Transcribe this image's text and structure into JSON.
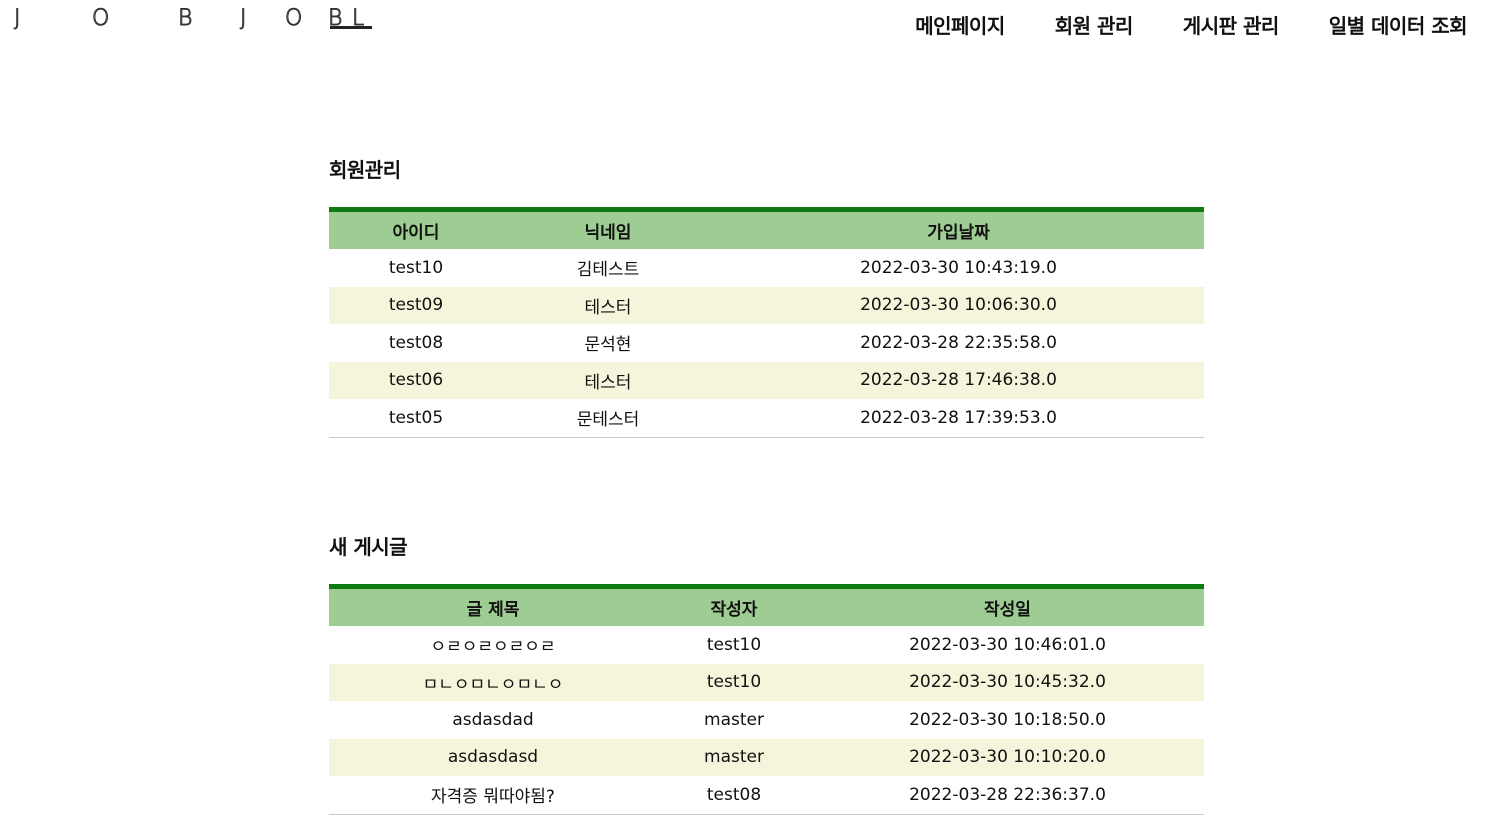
{
  "header": {
    "logo_letters": [
      "J",
      "O",
      "B",
      "J",
      "O",
      "B",
      "L"
    ],
    "nav": [
      {
        "label": "메인페이지"
      },
      {
        "label": "회원 관리"
      },
      {
        "label": "게시판 관리"
      },
      {
        "label": "일별 데이터 조회"
      }
    ]
  },
  "members": {
    "title": "회원관리",
    "columns": [
      "아이디",
      "닉네임",
      "가입날짜"
    ],
    "rows": [
      {
        "id": "test10",
        "nickname": "김테스트",
        "joined": "2022-03-30 10:43:19.0"
      },
      {
        "id": "test09",
        "nickname": "테스터",
        "joined": "2022-03-30 10:06:30.0"
      },
      {
        "id": "test08",
        "nickname": "문석현",
        "joined": "2022-03-28 22:35:58.0"
      },
      {
        "id": "test06",
        "nickname": "테스터",
        "joined": "2022-03-28 17:46:38.0"
      },
      {
        "id": "test05",
        "nickname": "문테스터",
        "joined": "2022-03-28 17:39:53.0"
      }
    ]
  },
  "posts": {
    "title": "새 게시글",
    "columns": [
      "글 제목",
      "작성자",
      "작성일"
    ],
    "rows": [
      {
        "title": "ㅇㄹㅇㄹㅇㄹㅇㄹ",
        "author": "test10",
        "date": "2022-03-30 10:46:01.0"
      },
      {
        "title": "ㅁㄴㅇㅁㄴㅇㅁㄴㅇ",
        "author": "test10",
        "date": "2022-03-30 10:45:32.0"
      },
      {
        "title": "asdasdad",
        "author": "master",
        "date": "2022-03-30 10:18:50.0"
      },
      {
        "title": "asdasdasd",
        "author": "master",
        "date": "2022-03-30 10:10:20.0"
      },
      {
        "title": "자격증 뭐따야됨?",
        "author": "test08",
        "date": "2022-03-28 22:36:37.0"
      }
    ]
  },
  "colors": {
    "table_top_border": "#0f7a12",
    "header_row_bg": "#9ecd93",
    "striped_row_bg": "#f5f5dc"
  }
}
